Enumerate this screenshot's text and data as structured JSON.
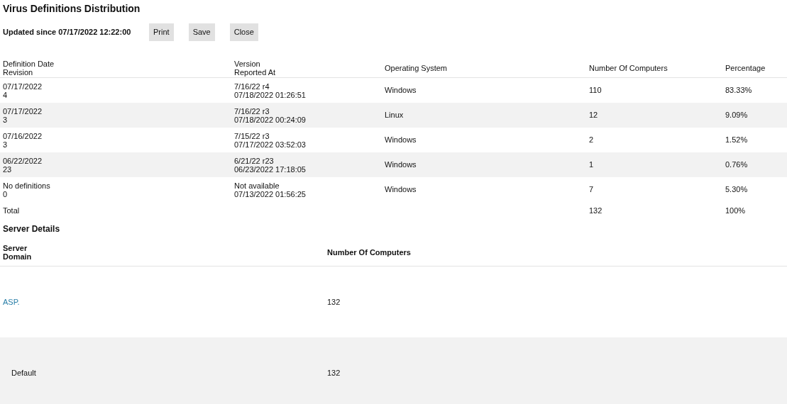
{
  "title": "Virus Definitions Distribution",
  "updated": "Updated since 07/17/2022 12:22:00",
  "buttons": [
    "Print",
    "Save",
    "Close"
  ],
  "definitions": {
    "columns": [
      [
        "Definition Date",
        "Revision"
      ],
      [
        "Version",
        "Reported At"
      ],
      [
        "Operating System"
      ],
      [
        "Number Of Computers"
      ],
      [
        "Percentage"
      ]
    ],
    "rows": [
      {
        "date": "07/17/2022",
        "revision": "4",
        "version": "7/16/22 r4",
        "reported": "07/18/2022 01:26:51",
        "os": "Windows",
        "computers": "110",
        "percentage": "83.33%"
      },
      {
        "date": "07/17/2022",
        "revision": "3",
        "version": "7/16/22 r3",
        "reported": "07/18/2022 00:24:09",
        "os": "Linux",
        "computers": "12",
        "percentage": "9.09%"
      },
      {
        "date": "07/16/2022",
        "revision": "3",
        "version": "7/15/22 r3",
        "reported": "07/17/2022 03:52:03",
        "os": "Windows",
        "computers": "2",
        "percentage": "1.52%"
      },
      {
        "date": "06/22/2022",
        "revision": "23",
        "version": "6/21/22 r23",
        "reported": "06/23/2022 17:18:05",
        "os": "Windows",
        "computers": "1",
        "percentage": "0.76%"
      },
      {
        "date": "No definitions",
        "revision": "0",
        "version": "Not available",
        "reported": "07/13/2022 01:56:25",
        "os": "Windows",
        "computers": "7",
        "percentage": "5.30%"
      }
    ],
    "total": {
      "label": "Total",
      "computers": "132",
      "percentage": "100%"
    }
  },
  "server_details": {
    "title": "Server Details",
    "columns": [
      [
        "Server",
        "Domain"
      ],
      [
        "Number Of Computers"
      ]
    ],
    "rows": [
      {
        "kind": "server",
        "name": "ASP.",
        "computers": "132"
      },
      {
        "kind": "domain",
        "name": "Default",
        "computers": "132"
      }
    ]
  }
}
